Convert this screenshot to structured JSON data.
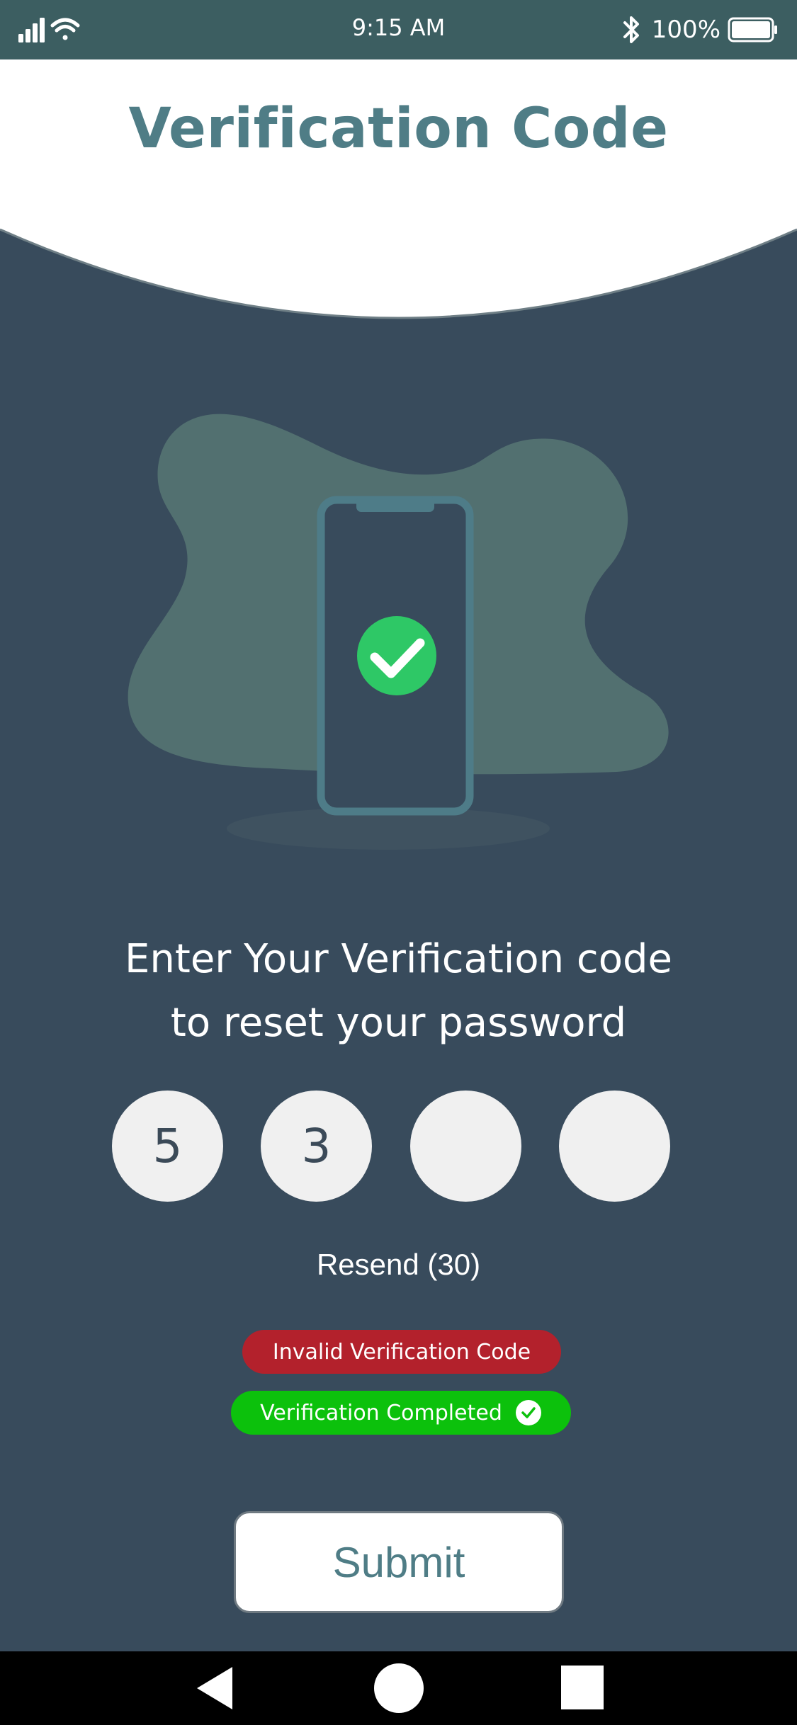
{
  "status_bar": {
    "time": "9:15 AM",
    "battery": "100%",
    "icons": [
      "signal-icon",
      "wifi-icon",
      "bluetooth-icon",
      "battery-icon"
    ]
  },
  "header": {
    "title": "Verification Code"
  },
  "illustration": {
    "icons": [
      "phone-icon",
      "checkmark-icon"
    ]
  },
  "instruction": {
    "line1": "Enter Your Verification code",
    "line2": "to reset your password"
  },
  "code": {
    "digits": [
      "5",
      "3",
      "",
      ""
    ]
  },
  "resend": {
    "label": "Resend (30)"
  },
  "messages": {
    "error": "Invalid Verification Code",
    "success": "Verification Completed"
  },
  "submit": {
    "label": "Submit"
  },
  "nav": {
    "icons": [
      "back-icon",
      "home-icon",
      "recents-icon"
    ]
  },
  "colors": {
    "background": "#384b5c",
    "status_bar": "#3c5e61",
    "accent": "#4f7d86",
    "blob": "#527070",
    "error": "#b3212c",
    "success": "#0cc10c",
    "check_circle": "#2ec866"
  }
}
